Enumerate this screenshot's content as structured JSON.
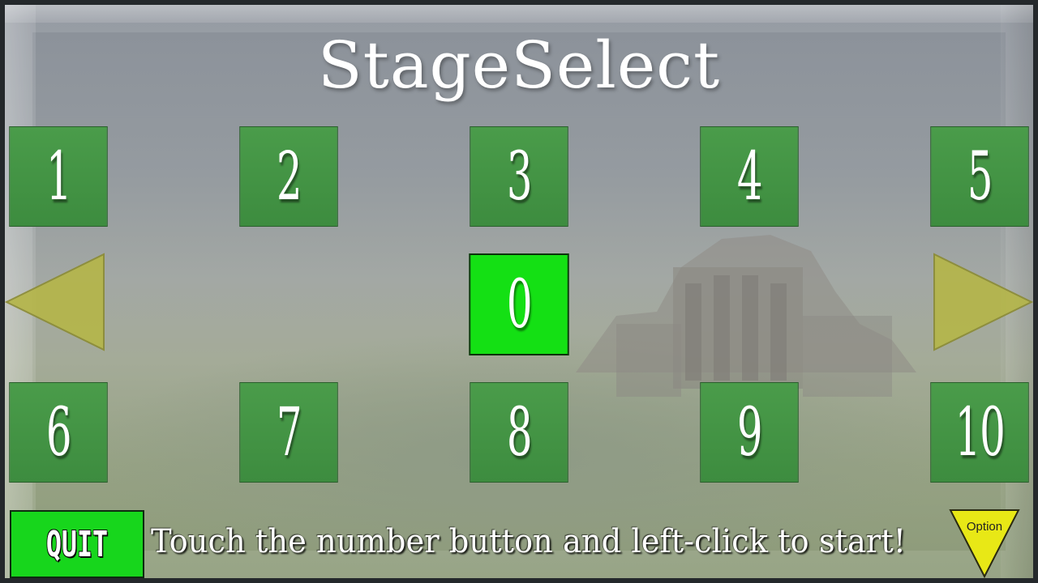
{
  "title": "StageSelect",
  "stages_row1": [
    "1",
    "2",
    "3",
    "4",
    "5"
  ],
  "current_stage": "0",
  "stages_row2": [
    "6",
    "7",
    "8",
    "9",
    "10"
  ],
  "quit_label": "QUIT",
  "hint_text": "Touch the number button and left-click to start!",
  "option_label": "Option",
  "icons": {
    "prev": "triangle-left-icon",
    "next": "triangle-right-icon",
    "option": "triangle-down-icon"
  },
  "colors": {
    "stage_button": "#3f8f41",
    "selected_button": "#14e014",
    "arrow": "#b8b84a",
    "option": "#e6e614",
    "quit": "#17d61c"
  }
}
